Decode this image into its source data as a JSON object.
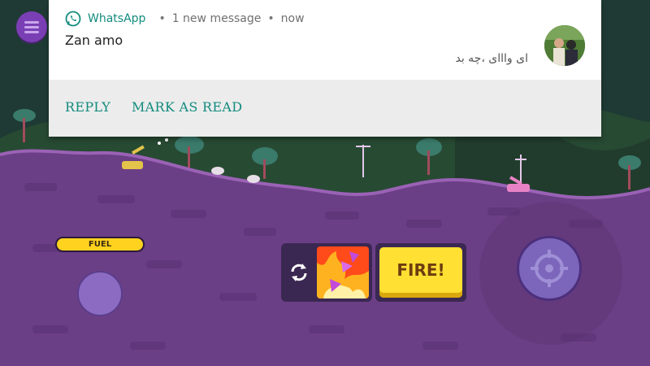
{
  "notification": {
    "app_name": "WhatsApp",
    "summary": "1 new message",
    "time": "now",
    "sender": "Zan amo",
    "message": "ای وااای ،چه بد",
    "actions": [
      "REPLY",
      "MARK AS READ"
    ],
    "accent_color": "#128c7e",
    "app_icon": "whatsapp-icon"
  },
  "game": {
    "fuel_label": "FUEL",
    "fire_label": "FIRE!",
    "swap_icon": "swap-arrows-icon",
    "menu_icon": "hamburger-menu-icon",
    "aim_icon": "crosshair-icon",
    "colors": {
      "ground": "#6b3f86",
      "ground_top": "#8b55a5",
      "sky": "#1f3a35",
      "fuel": "#ffd21f",
      "fire": "#ffe033"
    }
  }
}
